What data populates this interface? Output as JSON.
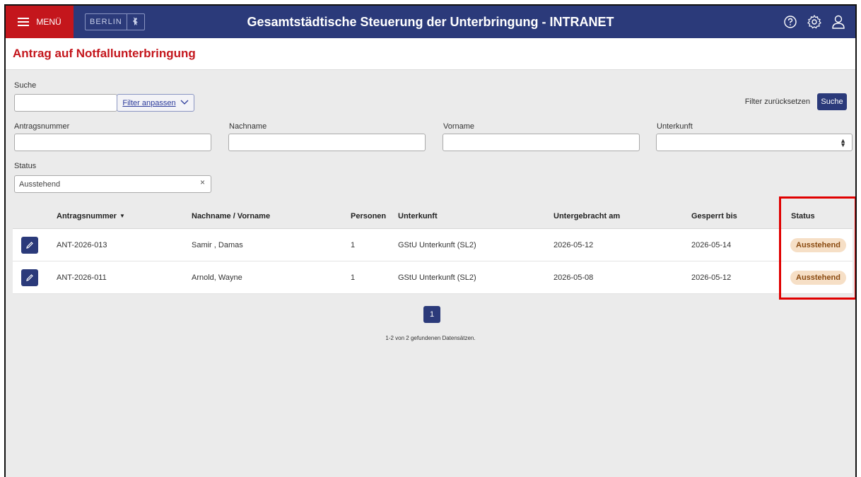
{
  "header": {
    "menu_label": "MENÜ",
    "logo_text": "BERLIN",
    "app_title": "Gesamtstädtische Steuerung der Unterbringung - INTRANET"
  },
  "page": {
    "title": "Antrag auf Notfallunterbringung"
  },
  "search": {
    "label": "Suche",
    "value": "",
    "filter_button": "Filter anpassen",
    "reset_link": "Filter zurücksetzen",
    "search_button": "Suche"
  },
  "filters": {
    "antragsnummer_label": "Antragsnummer",
    "nachname_label": "Nachname",
    "vorname_label": "Vorname",
    "unterkunft_label": "Unterkunft",
    "status_label": "Status",
    "status_value": "Ausstehend"
  },
  "table": {
    "columns": [
      "Antragsnummer",
      "Nachname / Vorname",
      "Personen",
      "Unterkunft",
      "Untergebracht am",
      "Gesperrt bis",
      "Status"
    ],
    "rows": [
      {
        "nummer": "ANT-2026-013",
        "name": "Samir , Damas",
        "personen": "1",
        "unterkunft": "GStU Unterkunft (SL2)",
        "untergebracht": "2026-05-12",
        "gesperrt": "2026-05-14",
        "status": "Ausstehend"
      },
      {
        "nummer": "ANT-2026-011",
        "name": "Arnold, Wayne",
        "personen": "1",
        "unterkunft": "GStU Unterkunft (SL2)",
        "untergebracht": "2026-05-08",
        "gesperrt": "2026-05-12",
        "status": "Ausstehend"
      }
    ]
  },
  "pagination": {
    "current_page": "1",
    "result_info": "1-2 von 2 gefundenen Datensätzen."
  },
  "colors": {
    "brand_blue": "#2b3a7a",
    "brand_red": "#c4161c",
    "status_badge_bg": "#f6dfc6",
    "highlight_red": "#e00000"
  },
  "icons": [
    "menu-icon",
    "berlin-bear-icon",
    "help-icon",
    "settings-icon",
    "user-icon",
    "chevron-down-icon",
    "clear-icon",
    "edit-icon",
    "sort-desc-icon"
  ]
}
